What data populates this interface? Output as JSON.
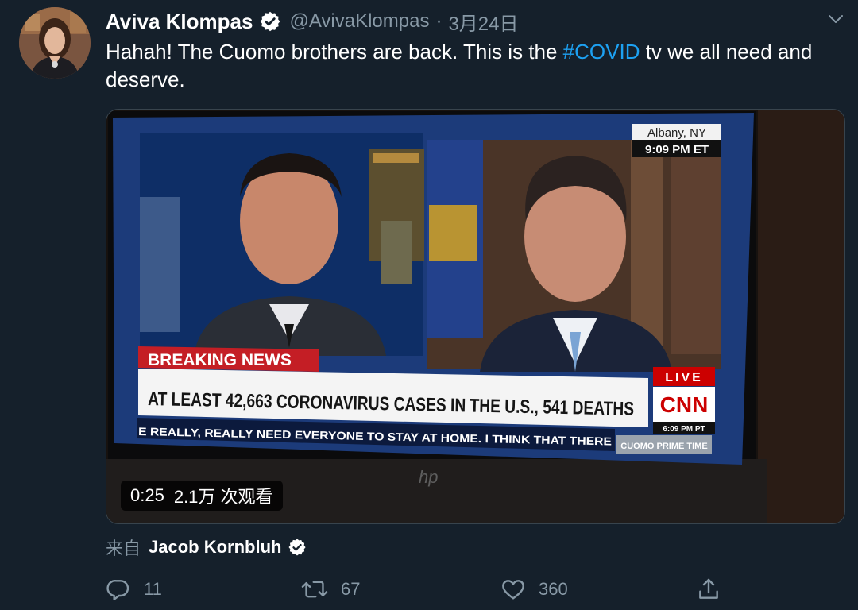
{
  "tweet": {
    "author_name": "Aviva Klompas",
    "handle": "@AvivaKlompas",
    "date": "3月24日",
    "text_before": "Hahah! The Cuomo brothers are back. This is the ",
    "hashtag": "#COVID",
    "text_after": " tv we all need and deserve."
  },
  "video": {
    "duration": "0:25",
    "views": "2.1万 次观看",
    "tv": {
      "location": "Albany, NY",
      "time_et": "9:09 PM ET",
      "breaking": "BREAKING NEWS",
      "headline": "AT LEAST 42,663 CORONAVIRUS CASES IN THE U.S., 541 DEATHS",
      "ticker": "E REALLY, REALLY NEED EVERYONE TO STAY AT HOME. I THINK THAT THERE",
      "show": "CUOMO PRIME TIME",
      "live": "LIVE",
      "network": "CNN",
      "time_pt": "6:09 PM PT",
      "brand": "hp"
    }
  },
  "from": {
    "prefix": "来自",
    "name": "Jacob Kornbluh"
  },
  "actions": {
    "replies": "11",
    "retweets": "67",
    "likes": "360"
  },
  "colors": {
    "background": "#15202b",
    "secondary_text": "#8899a6",
    "link": "#1da1f2",
    "verified": "#ffffff",
    "cnn_red": "#cc0000"
  },
  "icons": [
    "verified-badge-icon",
    "chevron-down-icon",
    "reply-icon",
    "retweet-icon",
    "like-icon",
    "share-icon"
  ]
}
